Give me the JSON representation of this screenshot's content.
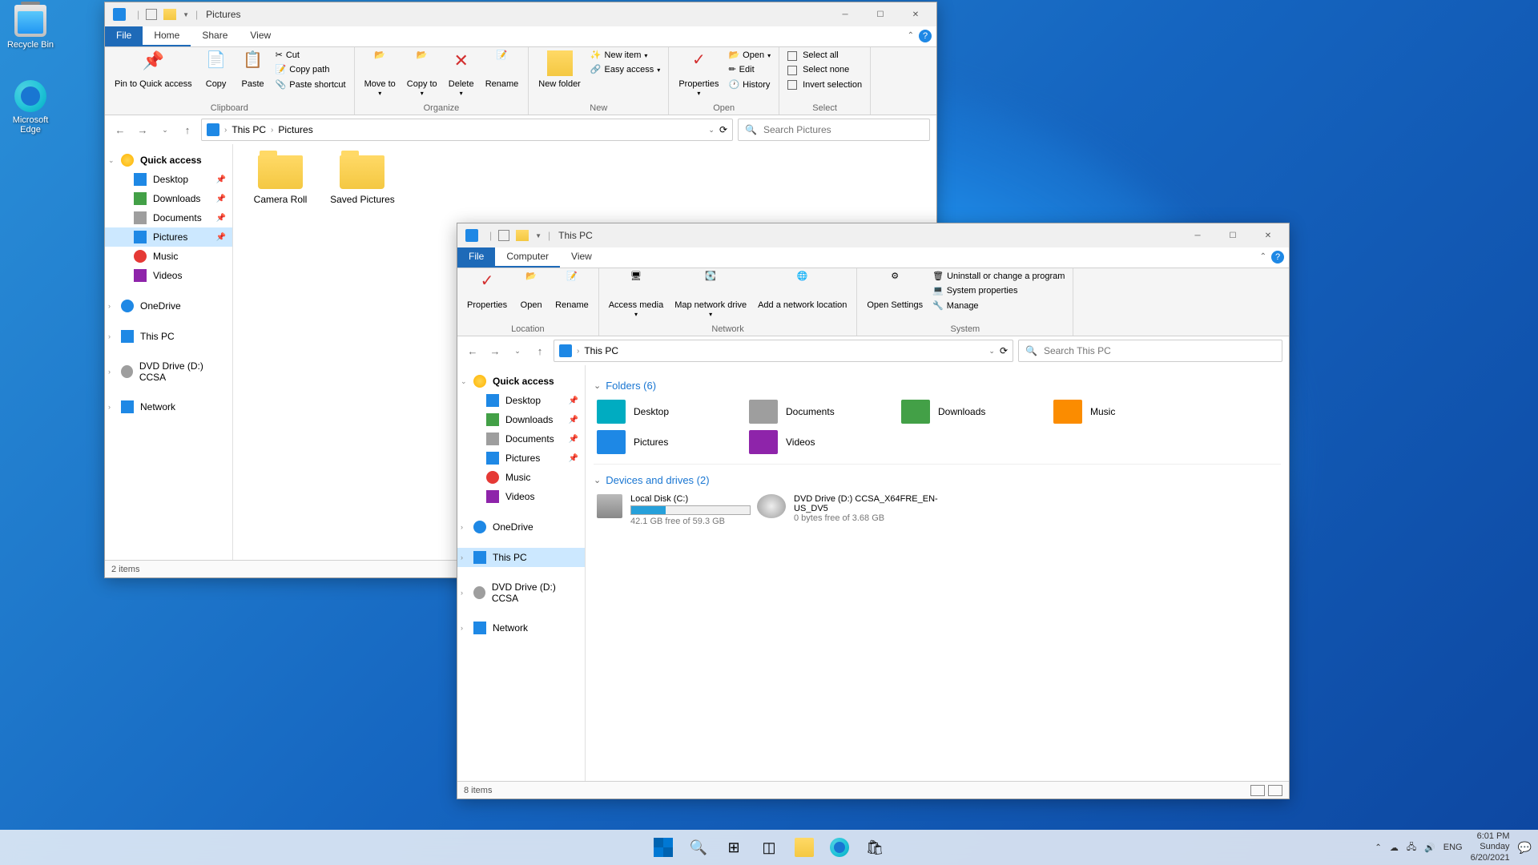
{
  "desktop": {
    "recycle_bin": "Recycle Bin",
    "edge": "Microsoft Edge"
  },
  "win1": {
    "title": "Pictures",
    "tabs": {
      "file": "File",
      "home": "Home",
      "share": "Share",
      "view": "View"
    },
    "ribbon": {
      "pin_qa": "Pin to Quick access",
      "copy": "Copy",
      "paste": "Paste",
      "cut": "Cut",
      "copy_path": "Copy path",
      "paste_shortcut": "Paste shortcut",
      "clipboard": "Clipboard",
      "move_to": "Move to",
      "copy_to": "Copy to",
      "delete": "Delete",
      "rename": "Rename",
      "organize": "Organize",
      "new_folder": "New folder",
      "new_item": "New item",
      "easy_access": "Easy access",
      "new": "New",
      "properties": "Properties",
      "open": "Open",
      "edit": "Edit",
      "history": "History",
      "open_grp": "Open",
      "select_all": "Select all",
      "select_none": "Select none",
      "invert": "Invert selection",
      "select": "Select"
    },
    "breadcrumb": {
      "root": "This PC",
      "leaf": "Pictures"
    },
    "search_placeholder": "Search Pictures",
    "nav": {
      "quick_access": "Quick access",
      "desktop": "Desktop",
      "downloads": "Downloads",
      "documents": "Documents",
      "pictures": "Pictures",
      "music": "Music",
      "videos": "Videos",
      "onedrive": "OneDrive",
      "this_pc": "This PC",
      "dvd": "DVD Drive (D:) CCSA",
      "network": "Network"
    },
    "content": {
      "camera_roll": "Camera Roll",
      "saved_pictures": "Saved Pictures"
    },
    "status": "2 items"
  },
  "win2": {
    "title": "This PC",
    "tabs": {
      "file": "File",
      "computer": "Computer",
      "view": "View"
    },
    "ribbon": {
      "properties": "Properties",
      "open": "Open",
      "rename": "Rename",
      "location": "Location",
      "access_media": "Access media",
      "map_drive": "Map network drive",
      "add_loc": "Add a network location",
      "network": "Network",
      "open_settings": "Open Settings",
      "uninstall": "Uninstall or change a program",
      "sys_props": "System properties",
      "manage": "Manage",
      "system": "System"
    },
    "breadcrumb": {
      "root": "This PC"
    },
    "search_placeholder": "Search This PC",
    "nav": {
      "quick_access": "Quick access",
      "desktop": "Desktop",
      "downloads": "Downloads",
      "documents": "Documents",
      "pictures": "Pictures",
      "music": "Music",
      "videos": "Videos",
      "onedrive": "OneDrive",
      "this_pc": "This PC",
      "dvd": "DVD Drive (D:) CCSA",
      "network": "Network"
    },
    "sections": {
      "folders": "Folders (6)",
      "drives": "Devices and drives (2)",
      "folder_items": {
        "desktop": "Desktop",
        "documents": "Documents",
        "downloads": "Downloads",
        "music": "Music",
        "pictures": "Pictures",
        "videos": "Videos"
      },
      "local_disk": {
        "name": "Local Disk (C:)",
        "free": "42.1 GB free of 59.3 GB",
        "fill_pct": 29
      },
      "dvd": {
        "name": "DVD Drive (D:) CCSA_X64FRE_EN-US_DV5",
        "free": "0 bytes free of 3.68 GB"
      }
    },
    "status": "8 items"
  },
  "taskbar": {
    "lang": "ENG",
    "time": "6:01 PM",
    "day": "Sunday",
    "date": "6/20/2021"
  }
}
